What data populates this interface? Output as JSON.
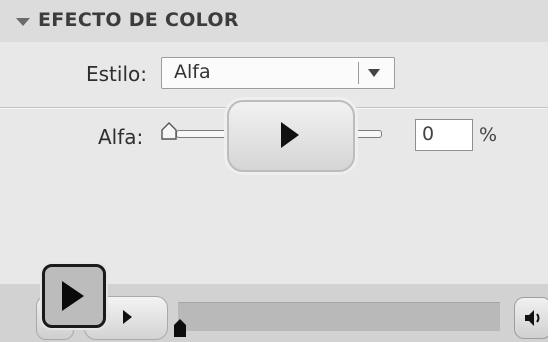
{
  "section": {
    "title": "EFECTO DE COLOR"
  },
  "style_row": {
    "label": "Estilo:",
    "value": "Alfa"
  },
  "alpha_row": {
    "label": "Alfa:",
    "value": "0",
    "unit": "%"
  },
  "slider": {
    "level_fraction": 0
  },
  "icons": {
    "collapse": "triangle-down-icon",
    "dropdown": "chevron-down-icon",
    "play": "play-icon",
    "volume": "speaker-icon",
    "slider_handle": "slider-handle-icon"
  }
}
